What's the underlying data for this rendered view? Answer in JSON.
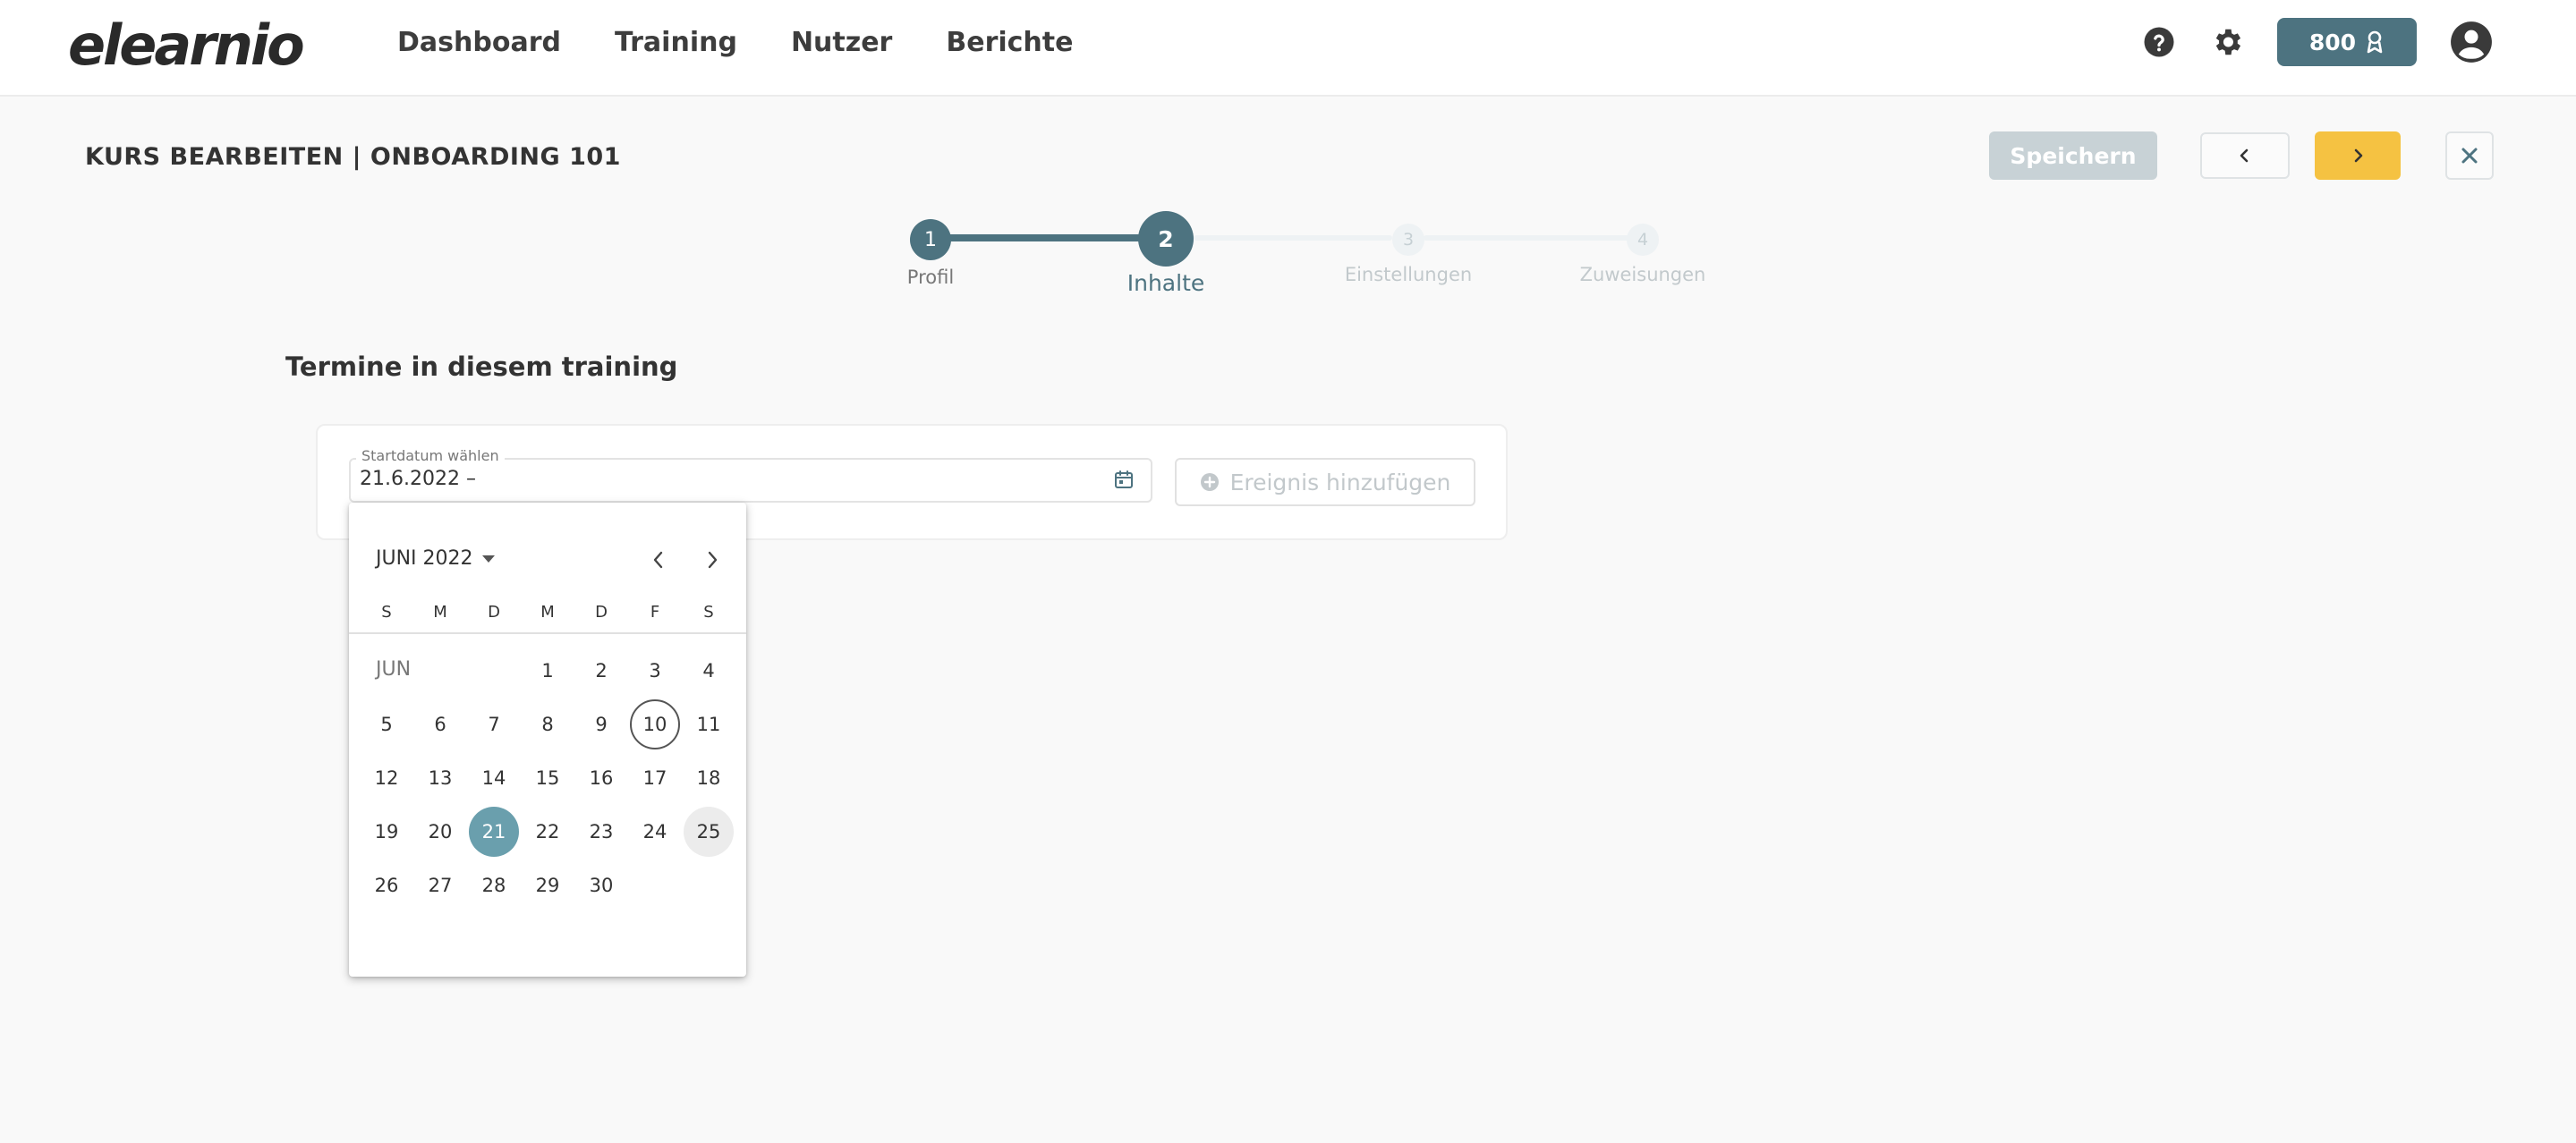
{
  "app": {
    "logo": "elearnio"
  },
  "nav": {
    "items": [
      "Dashboard",
      "Training",
      "Nutzer",
      "Berichte"
    ]
  },
  "header": {
    "points": "800"
  },
  "page": {
    "title": "KURS BEARBEITEN | ONBOARDING 101"
  },
  "actions": {
    "save_label": "Speichern"
  },
  "stepper": {
    "current_step": 2,
    "steps": [
      {
        "number": "1",
        "label": "Profil"
      },
      {
        "number": "2",
        "label": "Inhalte"
      },
      {
        "number": "3",
        "label": "Einstellungen"
      },
      {
        "number": "4",
        "label": "Zuweisungen"
      }
    ]
  },
  "section": {
    "title": "Termine in diesem training"
  },
  "date_field": {
    "label": "Startdatum wählen",
    "value": "21.6.2022 –"
  },
  "add_event": {
    "label": "Ereignis hinzufügen"
  },
  "datepicker": {
    "month_label": "JUNI 2022",
    "month_short": "JUN",
    "weekdays": [
      "S",
      "M",
      "D",
      "M",
      "D",
      "F",
      "S"
    ],
    "first_weekday_index": 3,
    "days_in_month": 30,
    "today": 10,
    "selected": 21,
    "hovered": 25
  },
  "colors": {
    "primary": "#4d7380",
    "accent": "#f5c242",
    "selected_day": "#6a9fad",
    "disabled": "#c8d2d6"
  }
}
